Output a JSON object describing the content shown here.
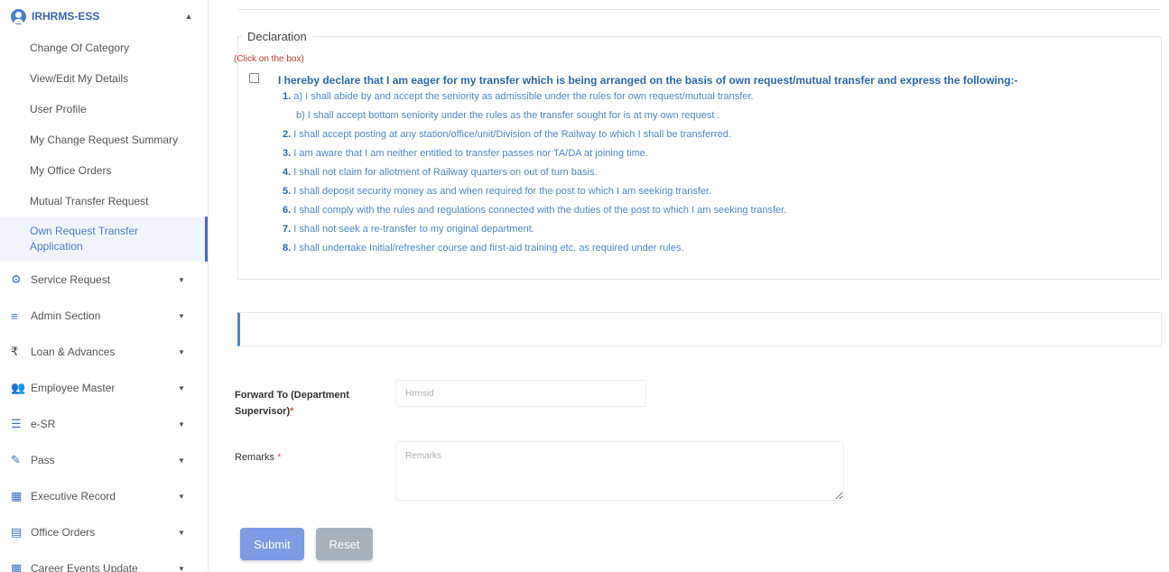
{
  "sidebar": {
    "header": "IRHRMS-ESS",
    "sub_items": [
      {
        "label": "Change Of Category"
      },
      {
        "label": "View/Edit My Details"
      },
      {
        "label": "User Profile"
      },
      {
        "label": "My Change Request Summary"
      },
      {
        "label": "My Office Orders"
      },
      {
        "label": "Mutual Transfer Request"
      },
      {
        "label": "Own Request Transfer Application"
      }
    ],
    "menu": [
      {
        "label": "Service Request",
        "icon": "cogs-icon"
      },
      {
        "label": "Admin Section",
        "icon": "bars-icon"
      },
      {
        "label": "Loan & Advances",
        "icon": "rupee-icon"
      },
      {
        "label": "Employee Master",
        "icon": "users-icon"
      },
      {
        "label": "e-SR",
        "icon": "database-icon"
      },
      {
        "label": "Pass",
        "icon": "ticket-icon"
      },
      {
        "label": "Executive Record",
        "icon": "table-icon"
      },
      {
        "label": "Office Orders",
        "icon": "file-icon"
      },
      {
        "label": "Career Events Update",
        "icon": "table-icon"
      }
    ]
  },
  "declaration": {
    "legend": "Declaration",
    "click_note": "(Click on the box)",
    "heading": "I hereby declare that I am eager for my transfer which is being arranged on the basis of own request/mutual transfer and express the following:-",
    "lines": [
      {
        "num": "1.",
        "text": "a) I shall abide by and accept the seniority as admissible under the rules for own request/mutual transfer."
      },
      {
        "num": "",
        "text": "b) I shall accept bottom seniority under the rules as the transfer sought for is at my own request ."
      },
      {
        "num": "2.",
        "text": "I shall accept posting at any station/office/unit/Division of the Railway to which I shall be transferred."
      },
      {
        "num": "3.",
        "text": "I am aware that I am neither entitled to transfer passes nor TA/DA at joining time."
      },
      {
        "num": "4.",
        "text": "I shall not claim for allotment of Railway quarters on out of turn basis."
      },
      {
        "num": "5.",
        "text": "I shall deposit security money as and when required for the post to which I am seeking transfer."
      },
      {
        "num": "6.",
        "text": "I shall comply with the rules and regulations connected with the duties of the post to which I am seeking transfer."
      },
      {
        "num": "7.",
        "text": "I shall not seek a re-transfer to my original department."
      },
      {
        "num": "8.",
        "text": "I shall undertake Initial/refresher course and first-aid training etc. as required under rules."
      }
    ]
  },
  "form": {
    "forward_label": "Forward To (Department Supervisor)",
    "forward_placeholder": "Hrmsid",
    "remarks_label": "Remarks",
    "remarks_placeholder": "Remarks",
    "required_mark": "*",
    "submit_label": "Submit",
    "reset_label": "Reset"
  },
  "colors": {
    "accent": "#3d6fc2",
    "declaration_text": "#4e86cc",
    "note_red": "#c0392b",
    "submit": "#7d9ce3",
    "reset": "#a8b0b8"
  }
}
